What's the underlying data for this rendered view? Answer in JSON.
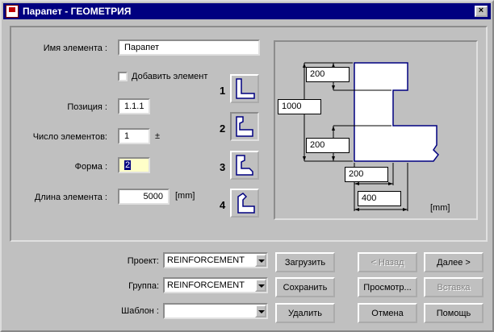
{
  "window": {
    "title": "Парапет - ГЕОМЕТРИЯ",
    "close": "×"
  },
  "form": {
    "name_label": "Имя элемента :",
    "name_value": "Парапет",
    "add_label": "Добавить элемент",
    "position_label": "Позиция :",
    "position_value": "1.1.1",
    "count_label": "Число элементов:",
    "count_value": "1",
    "count_pm": "±",
    "shape_label": "Форма :",
    "shape_value": "2",
    "length_label": "Длина элемента :",
    "length_value": "5000",
    "length_unit": "[mm]"
  },
  "shapes": [
    {
      "number": "1"
    },
    {
      "number": "2"
    },
    {
      "number": "3"
    },
    {
      "number": "4"
    }
  ],
  "preview": {
    "dim_top": "200",
    "dim_height": "1000",
    "dim_mid": "200",
    "dim_bottom_width": "200",
    "dim_total_width": "400",
    "unit": "[mm]"
  },
  "footer": {
    "project_label": "Проект:",
    "project_value": "REINFORCEMENT",
    "group_label": "Группа:",
    "group_value": "REINFORCEMENT",
    "template_label": "Шаблон :",
    "template_value": "",
    "load": "Загрузить",
    "save": "Сохранить",
    "delete": "Удалить",
    "back": "< Назад",
    "next": "Далее >",
    "preview": "Просмотр...",
    "insert": "Вставка",
    "cancel": "Отмена",
    "help": "Помощь"
  },
  "colors": {
    "titlebar": "#000080",
    "face": "#c0c0c0",
    "shape_outline": "#000080"
  }
}
